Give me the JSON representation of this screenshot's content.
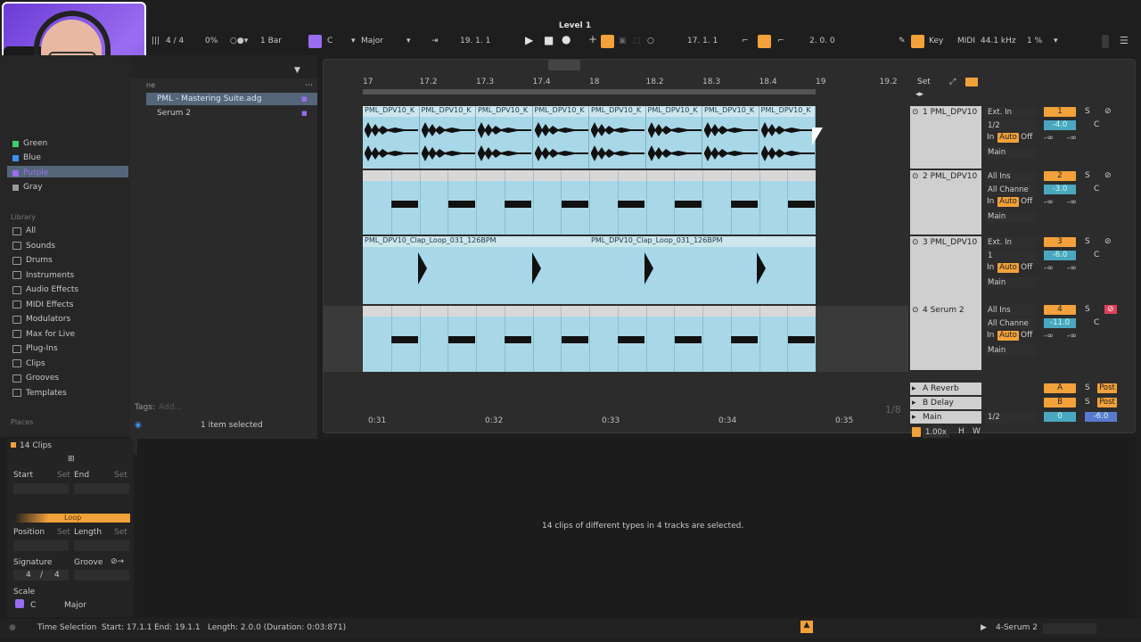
{
  "topbar": {
    "signature": "4 / 4",
    "cpu_percent": "0%",
    "quantize": "1 Bar",
    "scale_root": "C",
    "scale_name": "Major",
    "arrangement_position": "19.  1.  1",
    "loop_start": "17.  1.  1",
    "loop_length": "2.  0.  0",
    "key_label": "Key",
    "midi_label": "MIDI",
    "sample_rate": "44.1 kHz",
    "cpu_load": "1 %",
    "level_title": "Level 1"
  },
  "browser": {
    "colors": [
      {
        "label": "Green",
        "color": "#3ecf6a"
      },
      {
        "label": "Blue",
        "color": "#3d8ff0"
      },
      {
        "label": "Purple",
        "color": "#9a6cf0"
      },
      {
        "label": "Gray",
        "color": "#9a9a9a"
      }
    ],
    "library_heading": "Library",
    "library_items": [
      "All",
      "Sounds",
      "Drums",
      "Instruments",
      "Audio Effects",
      "MIDI Effects",
      "Modulators",
      "Max for Live",
      "Plug-Ins",
      "Clips",
      "Grooves",
      "Templates"
    ],
    "places_heading": "Places",
    "name_header": "ne",
    "files": [
      {
        "name": "PML - Mastering Suite.adg",
        "selected": true
      },
      {
        "name": "Serum 2",
        "selected": false
      }
    ],
    "tags_label": "Tags:",
    "tags_placeholder": "Add...",
    "selection_status": "1 item selected"
  },
  "arrangement": {
    "ruler": [
      "17",
      "17.2",
      "17.3",
      "17.4",
      "18",
      "18.2",
      "18.3",
      "18.4",
      "19",
      "19.2"
    ],
    "time_ruler": [
      "0:31",
      "0:32",
      "0:33",
      "0:34",
      "0:35"
    ],
    "clip_audio_name": "PML_DPV10_K",
    "clap_clip_name": "PML_DPV10_Clap_Loop_031_126BPM",
    "zoom_fraction": "1/8",
    "set_label": "Set"
  },
  "mixer": {
    "tracks": [
      {
        "name": "1 PML_DPV10",
        "input": "Ext. In",
        "channel": "1/2",
        "output": "Main",
        "number": "1",
        "volume": "-4.0",
        "pan": "C"
      },
      {
        "name": "2 PML_DPV10",
        "input": "All Ins",
        "channel": "All Channe",
        "output": "Main",
        "number": "2",
        "volume": "-3.0",
        "pan": "C"
      },
      {
        "name": "3 PML_DPV10",
        "input": "Ext. In",
        "channel": "1",
        "output": "Main",
        "number": "3",
        "volume": "-6.0",
        "pan": "C"
      },
      {
        "name": "4 Serum 2",
        "input": "All Ins",
        "channel": "All Channe",
        "output": "Main",
        "number": "4",
        "volume": "-11.0",
        "pan": "C"
      }
    ],
    "monitor_in": "In",
    "monitor_auto": "Auto",
    "monitor_off": "Off",
    "neg_inf": "-∞",
    "solo": "S",
    "returns": [
      {
        "name": "A Reverb",
        "letter": "A",
        "post": "Post"
      },
      {
        "name": "B Delay",
        "letter": "B",
        "post": "Post"
      }
    ],
    "main_name": "Main",
    "main_channel": "1/2",
    "main_vol": "0",
    "main_vol2": "-6.0",
    "speed": "1.00x",
    "h_label": "H",
    "w_label": "W"
  },
  "detail": {
    "clips_count": "14 Clips",
    "start_label": "Start",
    "end_label": "End",
    "set_label": "Set",
    "loop_label": "Loop",
    "position_label": "Position",
    "length_label": "Length",
    "signature_label": "Signature",
    "groove_label": "Groove",
    "sig_num": "4",
    "sig_den": "4",
    "scale_label": "Scale",
    "scale_root": "C",
    "scale_name": "Major",
    "message": "14 clips of different types in 4 tracks are selected."
  },
  "status": {
    "mode": "Time Selection",
    "start": "Start: 17.1.1",
    "end": "End: 19.1.1",
    "length": "Length: 2.0.0 (Duration: 0:03:871)",
    "track": "4-Serum 2"
  }
}
